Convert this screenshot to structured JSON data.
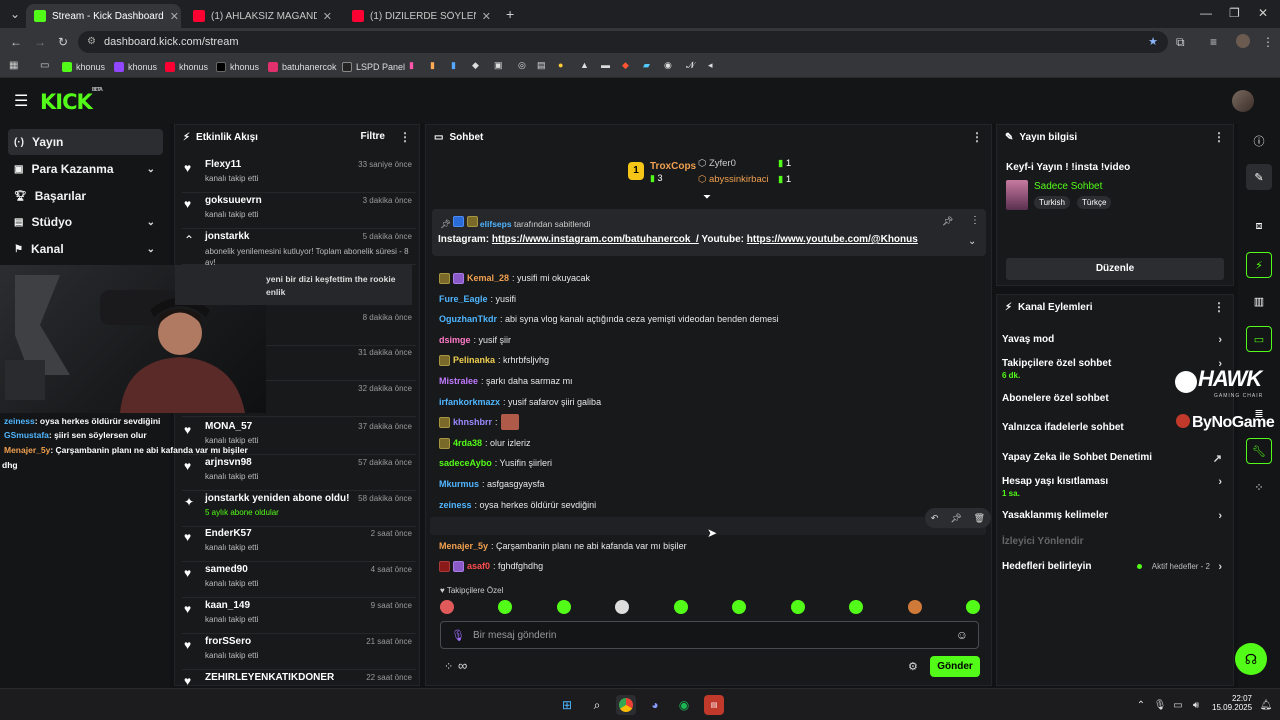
{
  "browser": {
    "tabs": [
      {
        "title": "Stream - Kick Dashboard",
        "favicon_color": "#53fc18"
      },
      {
        "title": "(1) AHLAKSIZ MAGANDA! Türk",
        "favicon_color": "#ff0033"
      },
      {
        "title": "(1) DİZİLERDE SÖYLENEN ŞARK",
        "favicon_color": "#ff0033"
      }
    ],
    "url": "dashboard.kick.com/stream",
    "bookmarks": [
      "khonus",
      "khonus",
      "khonus",
      "khonus",
      "batuhanercok",
      "LSPD Panel"
    ]
  },
  "kick": {
    "logo": "KICK",
    "logo_sup": "BETA"
  },
  "sidebar": {
    "items": [
      {
        "label": "Yayın",
        "icon": "broadcast-icon",
        "active": true
      },
      {
        "label": "Para Kazanma",
        "icon": "money-icon",
        "chevron": true
      },
      {
        "label": "Başarılar",
        "icon": "trophy-icon"
      },
      {
        "label": "Stüdyo",
        "icon": "studio-icon",
        "chevron": true
      },
      {
        "label": "Kanal",
        "icon": "channel-icon",
        "chevron": true
      }
    ]
  },
  "activity": {
    "title": "Etkinlik Akışı",
    "filter": "Filtre",
    "events": [
      {
        "name": "Flexy11",
        "time": "33 saniye önce",
        "sub": "kanalı takip etti",
        "icon": "heart-icon"
      },
      {
        "name": "goksuuevrn",
        "time": "3 dakika önce",
        "sub": "kanalı takip etti",
        "icon": "heart-icon"
      },
      {
        "name": "jonstarkk",
        "time": "5 dakika önce",
        "sub": "abonelik yenilemesini kutluyor! Toplam abonelik süresi - 8 ay!",
        "icon": "chevron-up-icon"
      },
      {
        "name": "yeni bir dizi keşfettim the rookie",
        "time": "",
        "sub": "enlik",
        "icon": ""
      },
      {
        "name": "",
        "time": "8 dakika önce",
        "sub": "",
        "icon": ""
      },
      {
        "name": "a",
        "time": "31 dakika önce",
        "sub": "",
        "icon": ""
      },
      {
        "name": "",
        "time": "32 dakika önce",
        "sub": "",
        "icon": ""
      },
      {
        "name": "MONA_57",
        "time": "37 dakika önce",
        "sub": "kanalı takip etti",
        "icon": "heart-icon"
      },
      {
        "name": "arjnsvn98",
        "time": "57 dakika önce",
        "sub": "kanalı takip etti",
        "icon": "heart-icon"
      },
      {
        "name": "jonstarkk yeniden abone oldu!",
        "time": "58 dakika önce",
        "sub": "5 aylık abone oldular",
        "icon": "sparkle-icon"
      },
      {
        "name": "EnderK57",
        "time": "2 saat önce",
        "sub": "kanalı takip etti",
        "icon": "heart-icon"
      },
      {
        "name": "samed90",
        "time": "4 saat önce",
        "sub": "kanalı takip etti",
        "icon": "heart-icon"
      },
      {
        "name": "kaan_149",
        "time": "9 saat önce",
        "sub": "kanalı takip etti",
        "icon": "heart-icon"
      },
      {
        "name": "frorSSero",
        "time": "21 saat önce",
        "sub": "kanalı takip etti",
        "icon": "heart-icon"
      },
      {
        "name": "ZEHIRLEYENKATIKDONER",
        "time": "22 saat önce",
        "sub": "",
        "icon": "heart-icon"
      }
    ]
  },
  "chat": {
    "title": "Sohbet",
    "leaders": {
      "first": {
        "rank": "1",
        "name": "TroxCops",
        "count": "3"
      },
      "others": [
        {
          "name": "Zyfer0",
          "count": "1"
        },
        {
          "name": "abyssinkirbaci",
          "count": "1"
        }
      ]
    },
    "pinned": {
      "by_user": "elifseps",
      "by_suffix": "tarafından sabitlendi",
      "instagram_label": "Instagram:",
      "instagram_url": "https://www.instagram.com/batuhanercok_/",
      "youtube_label": "Youtube:",
      "youtube_url": "https://www.youtube.com/@Khonus"
    },
    "messages": [
      {
        "user": "Kemal_28",
        "color": "#f0a050",
        "text": ": yusifi mi okuyacak",
        "badges": 2
      },
      {
        "user": "Fure_Eagle",
        "color": "#4fb6ff",
        "text": ": yusifi",
        "badges": 0
      },
      {
        "user": "OguzhanTkdr",
        "color": "#4fb6ff",
        "text": ": abi syna vlog kanalı açtığında ceza yemişti videodan benden demesi",
        "badges": 0
      },
      {
        "user": "dsimge",
        "color": "#ff7ac8",
        "text": ": yusif şiir",
        "badges": 0
      },
      {
        "user": "Pelinanka",
        "color": "#f0d050",
        "text": ": krhrbfsljvhg",
        "badges": 1
      },
      {
        "user": "Mistralee",
        "color": "#c07aff",
        "text": ": şarkı daha sarmaz mı",
        "badges": 0
      },
      {
        "user": "irfankorkmazx",
        "color": "#4fb6ff",
        "text": ": yusif safarov şiiri galiba",
        "badges": 0
      },
      {
        "user": "khnshbrr",
        "color": "#9a8aff",
        "text": ":",
        "badges": 1,
        "emote": true
      },
      {
        "user": "4rda38",
        "color": "#53fc18",
        "text": ": olur izleriz",
        "badges": 1
      },
      {
        "user": "sadeceAybo",
        "color": "#53fc18",
        "text": ": Yusifin şiirleri",
        "badges": 0
      },
      {
        "user": "Mkurmus",
        "color": "#4fb6ff",
        "text": ": asfgasgyaysfa",
        "badges": 0
      },
      {
        "user": "zeiness",
        "color": "#4fb6ff",
        "text": ": oysa herkes öldürür sevdiğini",
        "badges": 0
      },
      {
        "user": "GSmustafa",
        "color": "#4fb6ff",
        "text": ": şiiri sen söylersen olur",
        "badges": 0
      },
      {
        "user": "Menajer_5y",
        "color": "#f0a050",
        "text": ": Çarşambanin planı ne abi kafanda var mı bişiler",
        "badges": 0
      },
      {
        "user": "asaf0",
        "color": "#ff4d4d",
        "text": ": fghdfghdhg",
        "badges": 2
      }
    ],
    "followers_only": "Takipçilere Özel",
    "input_placeholder": "Bir mesaj gönderin",
    "send": "Gönder"
  },
  "stream_info": {
    "title": "Yayın bilgisi",
    "stream_title": "Keyf-i Yayın ! !insta !video",
    "category": "Sadece Sohbet",
    "tags": [
      "Turkish",
      "Türkçe"
    ],
    "edit": "Düzenle"
  },
  "channel_actions": {
    "title": "Kanal Eylemleri",
    "items": [
      {
        "label": "Yavaş mod",
        "sub": "",
        "right": "chevron"
      },
      {
        "label": "Takipçilere özel sohbet",
        "sub": "6 dk.",
        "right": "chevron"
      },
      {
        "label": "Abonelere özel sohbet",
        "sub": "",
        "right": ""
      },
      {
        "label": "Yalnızca ifadelerle sohbet",
        "sub": "",
        "right": ""
      },
      {
        "label": "Yapay Zeka ile Sohbet Denetimi",
        "sub": "",
        "right": "external"
      },
      {
        "label": "Hesap yaşı kısıtlaması",
        "sub": "1 sa.",
        "right": "chevron"
      },
      {
        "label": "Yasaklanmış kelimeler",
        "sub": "",
        "right": "chevron"
      },
      {
        "label": "İzleyici Yönlendir",
        "sub": "",
        "right": "",
        "disabled": true
      },
      {
        "label": "Hedefleri belirleyin",
        "sub": "",
        "right": "chevron",
        "status": "Aktif hedefler - 2"
      }
    ]
  },
  "webcam_overlay": {
    "lines": [
      {
        "user": "zeiness",
        "color": "#4fb6ff",
        "text": ": oysa herkes öldürür sevdiğini"
      },
      {
        "user": "GSmustafa",
        "color": "#4fb6ff",
        "text": ": şiiri sen söylersen olur"
      },
      {
        "user": "Menajer_5y",
        "color": "#f0a050",
        "text": ": Çarşambanin planı ne abi kafanda var mı bişiler"
      },
      {
        "user": "",
        "color": "#ffffff",
        "text": "dhg"
      }
    ],
    "brand_top": "HAWK",
    "brand_sub": "GAMING CHAIR",
    "brand_bottom": "ByNoGame"
  },
  "taskbar": {
    "time": "22:07",
    "date": "15.09.2025"
  },
  "colors": {
    "accent": "#53fc18",
    "panel": "#18191b",
    "background": "#111214"
  }
}
